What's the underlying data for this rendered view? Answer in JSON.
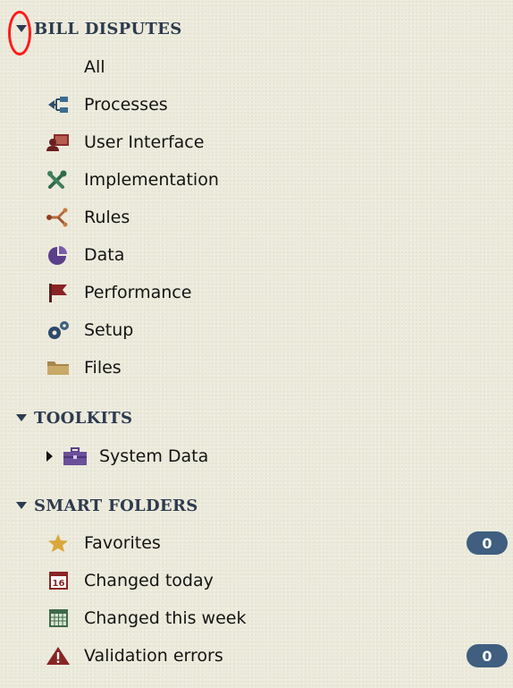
{
  "sections": {
    "bill_disputes": {
      "title": "BILL DISPUTES",
      "items": [
        {
          "label": "All",
          "icon": "none"
        },
        {
          "label": "Processes",
          "icon": "flow-icon"
        },
        {
          "label": "User Interface",
          "icon": "user-interface-icon"
        },
        {
          "label": "Implementation",
          "icon": "tools-icon"
        },
        {
          "label": "Rules",
          "icon": "rules-icon"
        },
        {
          "label": "Data",
          "icon": "pie-chart-icon"
        },
        {
          "label": "Performance",
          "icon": "flag-icon"
        },
        {
          "label": "Setup",
          "icon": "gears-icon"
        },
        {
          "label": "Files",
          "icon": "folder-icon"
        }
      ]
    },
    "toolkits": {
      "title": "TOOLKITS",
      "items": [
        {
          "label": "System Data",
          "icon": "briefcase-icon"
        }
      ]
    },
    "smart_folders": {
      "title": "SMART FOLDERS",
      "items": [
        {
          "label": "Favorites",
          "icon": "star-icon",
          "badge": "0"
        },
        {
          "label": "Changed today",
          "icon": "calendar-day-icon",
          "day": "16"
        },
        {
          "label": "Changed this week",
          "icon": "calendar-week-icon"
        },
        {
          "label": "Validation errors",
          "icon": "warning-icon",
          "badge": "0"
        }
      ]
    }
  },
  "colors": {
    "background": "#eceadb",
    "header_text": "#2d3b4e",
    "badge_bg": "#3f5e80",
    "annotation": "#ff1a1a"
  }
}
